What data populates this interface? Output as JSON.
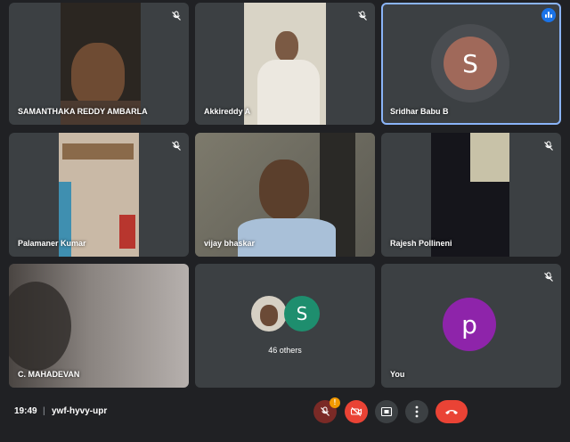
{
  "meeting": {
    "time": "19:49",
    "separator": "|",
    "code": "ywf-hyvy-upr"
  },
  "participants": [
    {
      "name": "SAMANTHAKA REDDY AMBARLA",
      "muted": true
    },
    {
      "name": "Akkireddy A",
      "muted": true
    },
    {
      "name": "Sridhar Babu B",
      "initial": "S",
      "speaking": true
    },
    {
      "name": "Palamaner Kumar",
      "muted": true
    },
    {
      "name": "vijay bhaskar",
      "muted": false
    },
    {
      "name": "Rajesh Pollineni",
      "muted": true
    },
    {
      "name": "C. MAHADEVAN",
      "muted": false
    },
    {
      "others_label": "46 others",
      "initial": "S"
    },
    {
      "name": "You",
      "initial": "p",
      "muted": true
    }
  ],
  "controls": {
    "mic_badge": "!",
    "icons": [
      "mic-off-icon",
      "camera-off-icon",
      "present-screen-icon",
      "more-options-icon",
      "end-call-icon"
    ]
  },
  "colors": {
    "background": "#202124",
    "tile": "#3c4043",
    "active_border": "#8ab4f8",
    "speaking_badge": "#1a73e8",
    "sridhar_avatar": "#a0695a",
    "others_avatar": "#1e8e6e",
    "you_avatar": "#8e24aa",
    "end_call": "#ea4335"
  }
}
